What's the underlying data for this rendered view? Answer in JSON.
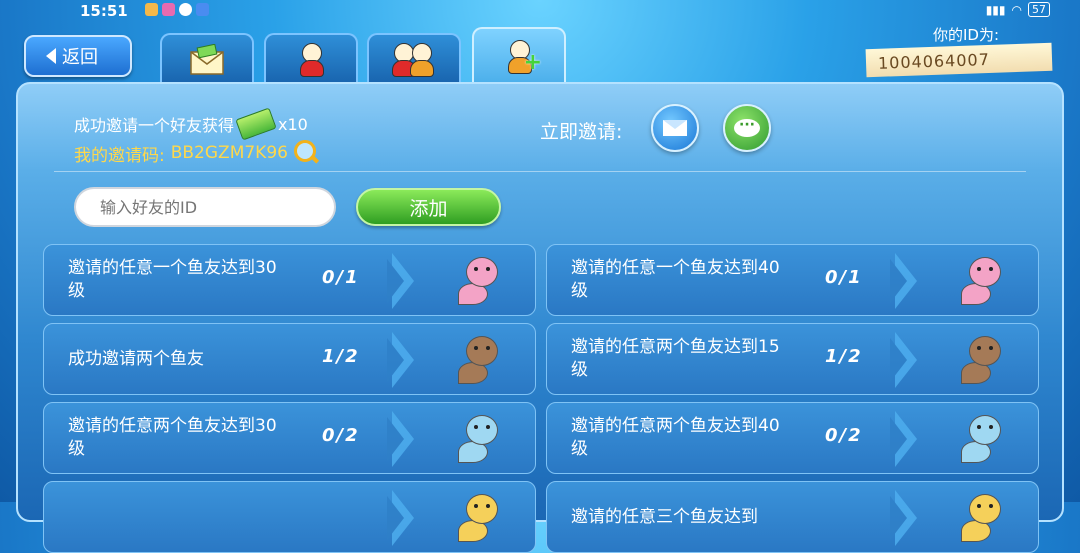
{
  "status_bar": {
    "time": "15:51",
    "battery": "57"
  },
  "nav": {
    "back_label": "返回"
  },
  "tabs": [
    {
      "name": "mail-gift"
    },
    {
      "name": "single-friend"
    },
    {
      "name": "friends"
    },
    {
      "name": "add-friend",
      "active": true
    }
  ],
  "user": {
    "id_label": "你的ID为:",
    "id_value": "1004064007"
  },
  "invite": {
    "reward_text": "成功邀请一个好友获得",
    "reward_count": "x10",
    "code_label": "我的邀请码:",
    "code_value": "BB2GZM7K96",
    "invite_now_label": "立即邀请:"
  },
  "add_friend": {
    "placeholder": "输入好友的ID",
    "button_label": "添加"
  },
  "tasks": [
    {
      "label": "邀请的任意一个鱼友达到30级",
      "progress": "0/1",
      "fish_color": "#f3a3c6"
    },
    {
      "label": "邀请的任意一个鱼友达到40级",
      "progress": "0/1",
      "fish_color": "#f3a3c6"
    },
    {
      "label": "成功邀请两个鱼友",
      "progress": "1/2",
      "fish_color": "#a57a57"
    },
    {
      "label": "邀请的任意两个鱼友达到15级",
      "progress": "1/2",
      "fish_color": "#a57a57"
    },
    {
      "label": "邀请的任意两个鱼友达到30级",
      "progress": "0/2",
      "fish_color": "#9fd8f2"
    },
    {
      "label": "邀请的任意两个鱼友达到40级",
      "progress": "0/2",
      "fish_color": "#9fd8f2"
    },
    {
      "label": "",
      "progress": "",
      "fish_color": "#f5d05a"
    },
    {
      "label": "邀请的任意三个鱼友达到",
      "progress": "",
      "fish_color": "#f5d05a"
    }
  ],
  "colors": {
    "accent": "#2a78c4",
    "code": "#ffd84a",
    "add_button": "#3aa52a"
  }
}
